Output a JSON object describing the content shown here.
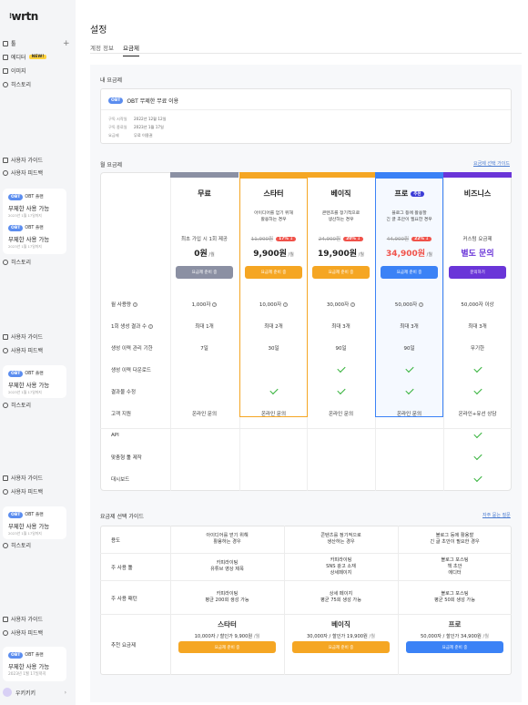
{
  "sidebar": {
    "logo": "wrtn",
    "tools_label": "툴",
    "items": [
      {
        "label": "에디터",
        "badge": "NEW!"
      },
      {
        "label": "이미지"
      },
      {
        "label": "히스토리"
      }
    ],
    "guide": "사용자 가이드",
    "feedback": "사용자 피드백",
    "card": {
      "badge": "OBT",
      "status": "OBT 플랜",
      "plan": "무제한 사용 가능",
      "date": "2023년 1월 17일까지"
    },
    "history": "히스토리",
    "user": "우키키키"
  },
  "page": {
    "title": "설정",
    "tabs": [
      "계정 정보",
      "요금제"
    ]
  },
  "current_plan": {
    "section": "내 요금제",
    "badge": "OBT",
    "name": "OBT 무제한 무료 이용",
    "rows": [
      {
        "k": "구독 시작일",
        "v": "2022년 12월 12일"
      },
      {
        "k": "구독 종료일",
        "v": "2023년 1월 17일"
      },
      {
        "k": "요금제",
        "v": "무료 이용권"
      }
    ]
  },
  "plans_section": {
    "title": "월 요금제",
    "link": "요금제 선택 가이드"
  },
  "colors": {
    "free": "#8b90a3",
    "starter": "#f5a623",
    "basic": "#f5a623",
    "pro": "#3b82f6",
    "business": "#6a35d8",
    "check": "#34b23a"
  },
  "plans": [
    {
      "name": "무료",
      "desc1": "",
      "desc2": "",
      "old": "",
      "disc": "",
      "price": "0원",
      "unit": "/월",
      "price_note": "최초 가입 시 1회 제공",
      "btn": "요금제 준비 중"
    },
    {
      "name": "스타터",
      "desc1": "아이디어를 얻기 위해",
      "desc2": "활용하는 경우",
      "old": "11,900원",
      "disc": "17% ↓",
      "price": "9,900원",
      "unit": "/월",
      "btn": "요금제 준비 중"
    },
    {
      "name": "베이직",
      "desc1": "콘텐츠를 정기적으로",
      "desc2": "생산하는 경우",
      "old": "24,900원",
      "disc": "20% ↓",
      "price": "19,900원",
      "unit": "/월",
      "btn": "요금제 준비 중"
    },
    {
      "name": "프로",
      "badge": "추천",
      "desc1": "블로그 등에 활용할",
      "desc2": "긴 글 초안이 필요한 경우",
      "old": "44,900원",
      "disc": "22% ↓",
      "price": "34,900원",
      "unit": "/월",
      "btn": "요금제 준비 중"
    },
    {
      "name": "비즈니스",
      "desc1": "",
      "desc2": "",
      "old": "",
      "disc": "",
      "price_note": "커스텀 요금제",
      "price": "별도 문의",
      "unit": "",
      "btn": "문의하기"
    }
  ],
  "features": [
    {
      "label": "월 사용량",
      "q": true,
      "cells": [
        "1,000자",
        "10,000자",
        "30,000자",
        "50,000자",
        "50,000자 이상"
      ],
      "cq": [
        true,
        true,
        true,
        true,
        false
      ]
    },
    {
      "label": "1회 생성 결과 수",
      "q": true,
      "cells": [
        "최대 1개",
        "최대 2개",
        "최대 3개",
        "최대 3개",
        "최대 3개"
      ]
    },
    {
      "label": "생성 이력 관리 기한",
      "cells": [
        "7일",
        "30일",
        "90일",
        "90일",
        "무기한"
      ]
    },
    {
      "label": "생성 이력 다운로드",
      "checks": [
        false,
        false,
        true,
        true,
        true
      ]
    },
    {
      "label": "결과물 수정",
      "checks": [
        false,
        true,
        true,
        true,
        true
      ]
    },
    {
      "label": "고객 지원",
      "cells": [
        "온라인 문의",
        "온라인 문의",
        "온라인 문의",
        "온라인 문의",
        "온라인+유선 상담"
      ]
    },
    {
      "label": "API",
      "checks": [
        false,
        false,
        false,
        false,
        true
      ]
    },
    {
      "label": "맞춤형 툴 제작",
      "checks": [
        false,
        false,
        false,
        false,
        true
      ]
    },
    {
      "label": "대시보드",
      "checks": [
        false,
        false,
        false,
        false,
        true
      ]
    }
  ],
  "guide": {
    "title": "요금제 선택 가이드",
    "link": "자주 묻는 질문",
    "rows": [
      {
        "label": "용도",
        "cells": [
          [
            "아이디어를 얻기 위해",
            "활용하는 경우"
          ],
          [
            "콘텐츠를 정기적으로",
            "생산하는 경우"
          ],
          [
            "블로그 등에 활용할",
            "긴 글 초안이 필요한 경우"
          ]
        ]
      },
      {
        "label": "주 사용 툴",
        "cells": [
          [
            "카피라이팅",
            "유튜브 영상 제목"
          ],
          [
            "카피라이팅",
            "SNS 광고 소재",
            "상세페이지"
          ],
          [
            "블로그 포스팅",
            "책 초안",
            "에디터"
          ]
        ]
      },
      {
        "label": "주 사용 패턴",
        "cells": [
          [
            "카피라이팅",
            "평균 200회 생성 가능"
          ],
          [
            "상세 페이지",
            "평균 75회 생성 가능"
          ],
          [
            "블로그 포스팅",
            "평균 50회 생성 가능"
          ]
        ]
      }
    ],
    "reco_label": "추천 요금제",
    "reco": [
      {
        "name": "스타터",
        "line": "10,000자 / 할인가 9,900원",
        "unit": "/월",
        "btn": "요금제 준비 중"
      },
      {
        "name": "베이직",
        "line": "30,000자 / 할인가 19,900원",
        "unit": "/월",
        "btn": "요금제 준비 중"
      },
      {
        "name": "프로",
        "line": "50,000자 / 할인가 34,900원",
        "unit": "/월",
        "btn": "요금제 준비 중"
      }
    ]
  }
}
